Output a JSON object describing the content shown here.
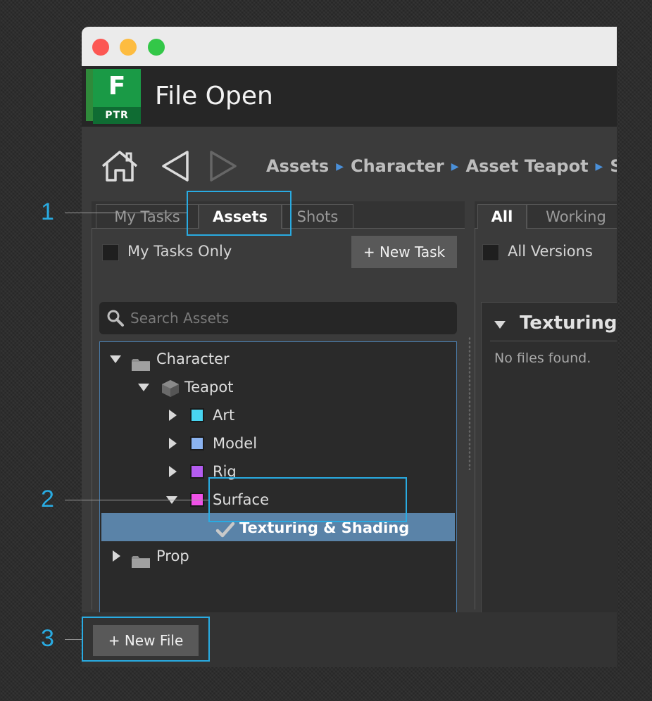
{
  "app": {
    "logo_letter": "F",
    "logo_sub": "PTR",
    "title": "File Open"
  },
  "nav": {
    "breadcrumbs": [
      "Assets",
      "Character",
      "Asset Teapot",
      "Ste"
    ]
  },
  "left_panel": {
    "tabs": [
      {
        "label": "My Tasks",
        "active": false
      },
      {
        "label": "Assets",
        "active": true
      },
      {
        "label": "Shots",
        "active": false
      }
    ],
    "my_tasks_only_label": "My Tasks Only",
    "new_task_label": "+ New Task",
    "search_placeholder": "Search Assets",
    "tree": [
      {
        "label": "Character",
        "icon": "folder-icon",
        "expanded": true
      },
      {
        "label": "Teapot",
        "icon": "cube-icon",
        "expanded": true
      },
      {
        "label": "Art",
        "color": "#48d4f0",
        "expanded": false
      },
      {
        "label": "Model",
        "color": "#8bb3f0",
        "expanded": false
      },
      {
        "label": "Rig",
        "color": "#b45cf0",
        "expanded": false
      },
      {
        "label": "Surface",
        "color": "#f051e8",
        "expanded": true
      },
      {
        "label": "Texturing & Shading",
        "icon": "checkmark-icon",
        "selected": true
      },
      {
        "label": "Prop",
        "icon": "folder-icon",
        "expanded": false
      }
    ]
  },
  "right_panel": {
    "tabs": [
      {
        "label": "All",
        "active": true
      },
      {
        "label": "Working",
        "active": false
      }
    ],
    "all_versions_label": "All Versions",
    "section_title": "Texturing",
    "empty_message": "No files found."
  },
  "footer": {
    "new_file_label": "+ New File"
  },
  "callouts": [
    "1",
    "2",
    "3"
  ],
  "colors": {
    "accent_callout": "#29abe2",
    "selection": "#5a83a8",
    "logo_green": "#1a9a46"
  }
}
